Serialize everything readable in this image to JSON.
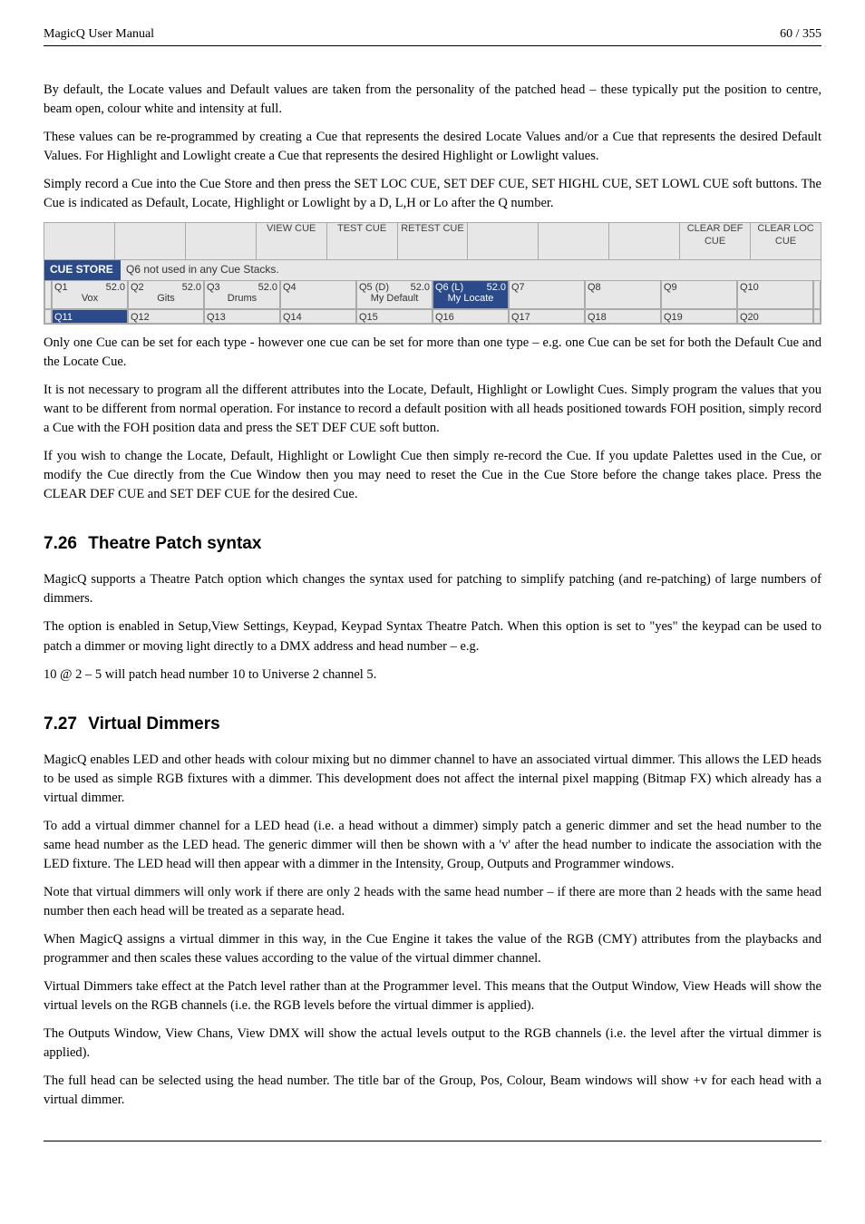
{
  "header": {
    "title": "MagicQ User Manual",
    "page": "60 / 355"
  },
  "intro": {
    "p1": "By default, the Locate values and Default values are taken from the personality of the patched head – these typically put the position to centre, beam open, colour white and intensity at full.",
    "p2": "These values can be re-programmed by creating a Cue that represents the desired Locate Values and/or a Cue that represents the desired Default Values. For Highlight and Lowlight create a Cue that represents the desired Highlight or Lowlight values.",
    "p3": "Simply record a Cue into the Cue Store and then press the SET LOC CUE, SET DEF CUE, SET HIGHL CUE, SET LOWL CUE soft buttons. The Cue is indicated as Default, Locate, Highlight or Lowlight by a D, L,H or Lo after the Q number."
  },
  "app": {
    "soft_row": [
      "",
      "",
      "",
      "VIEW CUE",
      "TEST CUE",
      "RETEST CUE",
      "",
      "",
      "",
      "CLEAR DEF CUE",
      "CLEAR LOC CUE"
    ],
    "cue_store_title": "CUE STORE",
    "cue_store_note": "Q6 not used in any Cue Stacks.",
    "row1": [
      {
        "q": "Q1",
        "r": "52.0",
        "sub": "Vox",
        "sel": false
      },
      {
        "q": "Q2",
        "r": "52.0",
        "sub": "Gits",
        "sel": false
      },
      {
        "q": "Q3",
        "r": "52.0",
        "sub": "Drums",
        "sel": false
      },
      {
        "q": "Q4",
        "r": "",
        "sub": "",
        "sel": false
      },
      {
        "q": "Q5 (D)",
        "r": "52.0",
        "sub": "My Default",
        "sel": false
      },
      {
        "q": "Q6 (L)",
        "r": "52.0",
        "sub": "My Locate",
        "sel": true
      },
      {
        "q": "Q7",
        "r": "",
        "sub": "",
        "sel": false
      },
      {
        "q": "Q8",
        "r": "",
        "sub": "",
        "sel": false
      },
      {
        "q": "Q9",
        "r": "",
        "sub": "",
        "sel": false
      },
      {
        "q": "Q10",
        "r": "",
        "sub": "",
        "sel": false
      }
    ],
    "row2": [
      {
        "q": "Q11",
        "sel": true
      },
      {
        "q": "Q12",
        "sel": false
      },
      {
        "q": "Q13",
        "sel": false
      },
      {
        "q": "Q14",
        "sel": false
      },
      {
        "q": "Q15",
        "sel": false
      },
      {
        "q": "Q16",
        "sel": false
      },
      {
        "q": "Q17",
        "sel": false
      },
      {
        "q": "Q18",
        "sel": false
      },
      {
        "q": "Q19",
        "sel": false
      },
      {
        "q": "Q20",
        "sel": false
      }
    ]
  },
  "after": {
    "p1": "Only one Cue can be set for each type - however one cue can be set for more than one type – e.g. one Cue can be set for both the Default Cue and the Locate Cue.",
    "p2": "It is not necessary to program all the different attributes into the Locate, Default, Highlight or Lowlight Cues. Simply program the values that you want to be different from normal operation. For instance to record a default position with all heads positioned towards FOH position, simply record a Cue with the FOH position data and press the SET DEF CUE soft button.",
    "p3": "If you wish to change the Locate, Default, Highlight or Lowlight Cue then simply re-record the Cue. If you update Palettes used in the Cue, or modify the Cue directly from the Cue Window then you may need to reset the Cue in the Cue Store before the change takes place. Press the CLEAR DEF CUE and SET DEF CUE for the desired Cue."
  },
  "sec726": {
    "num": "7.26",
    "title": "Theatre Patch syntax",
    "p1": "MagicQ supports a Theatre Patch option which changes the syntax used for patching to simplify patching (and re-patching) of large numbers of dimmers.",
    "p2": "The option is enabled in Setup,View Settings, Keypad, Keypad Syntax Theatre Patch. When this option is set to \"yes\" the keypad can be used to patch a dimmer or moving light directly to a DMX address and head number – e.g.",
    "p3": "10 @ 2 – 5 will patch head number 10 to Universe 2 channel 5."
  },
  "sec727": {
    "num": "7.27",
    "title": "Virtual Dimmers",
    "p1": "MagicQ enables LED and other heads with colour mixing but no dimmer channel to have an associated virtual dimmer. This allows the LED heads to be used as simple RGB fixtures with a dimmer. This development does not affect the internal pixel mapping (Bitmap FX) which already has a virtual dimmer.",
    "p2": "To add a virtual dimmer channel for a LED head (i.e. a head without a dimmer) simply patch a generic dimmer and set the head number to the same head number as the LED head. The generic dimmer will then be shown with a 'v' after the head number to indicate the association with the LED fixture. The LED head will then appear with a dimmer in the Intensity, Group, Outputs and Programmer windows.",
    "p3": "Note that virtual dimmers will only work if there are only 2 heads with the same head number – if there are more than 2 heads with the same head number then each head will be treated as a separate head.",
    "p4": "When MagicQ assigns a virtual dimmer in this way, in the Cue Engine it takes the value of the RGB (CMY) attributes from the playbacks and programmer and then scales these values according to the value of the virtual dimmer channel.",
    "p5": "Virtual Dimmers take effect at the Patch level rather than at the Programmer level. This means that the Output Window, View Heads will show the virtual levels on the RGB channels (i.e. the RGB levels before the virtual dimmer is applied).",
    "p6": "The Outputs Window, View Chans, View DMX will show the actual levels output to the RGB channels (i.e. the level after the virtual dimmer is applied).",
    "p7": "The full head can be selected using the head number. The title bar of the Group, Pos, Colour, Beam windows will show +v for each head with a virtual dimmer."
  }
}
